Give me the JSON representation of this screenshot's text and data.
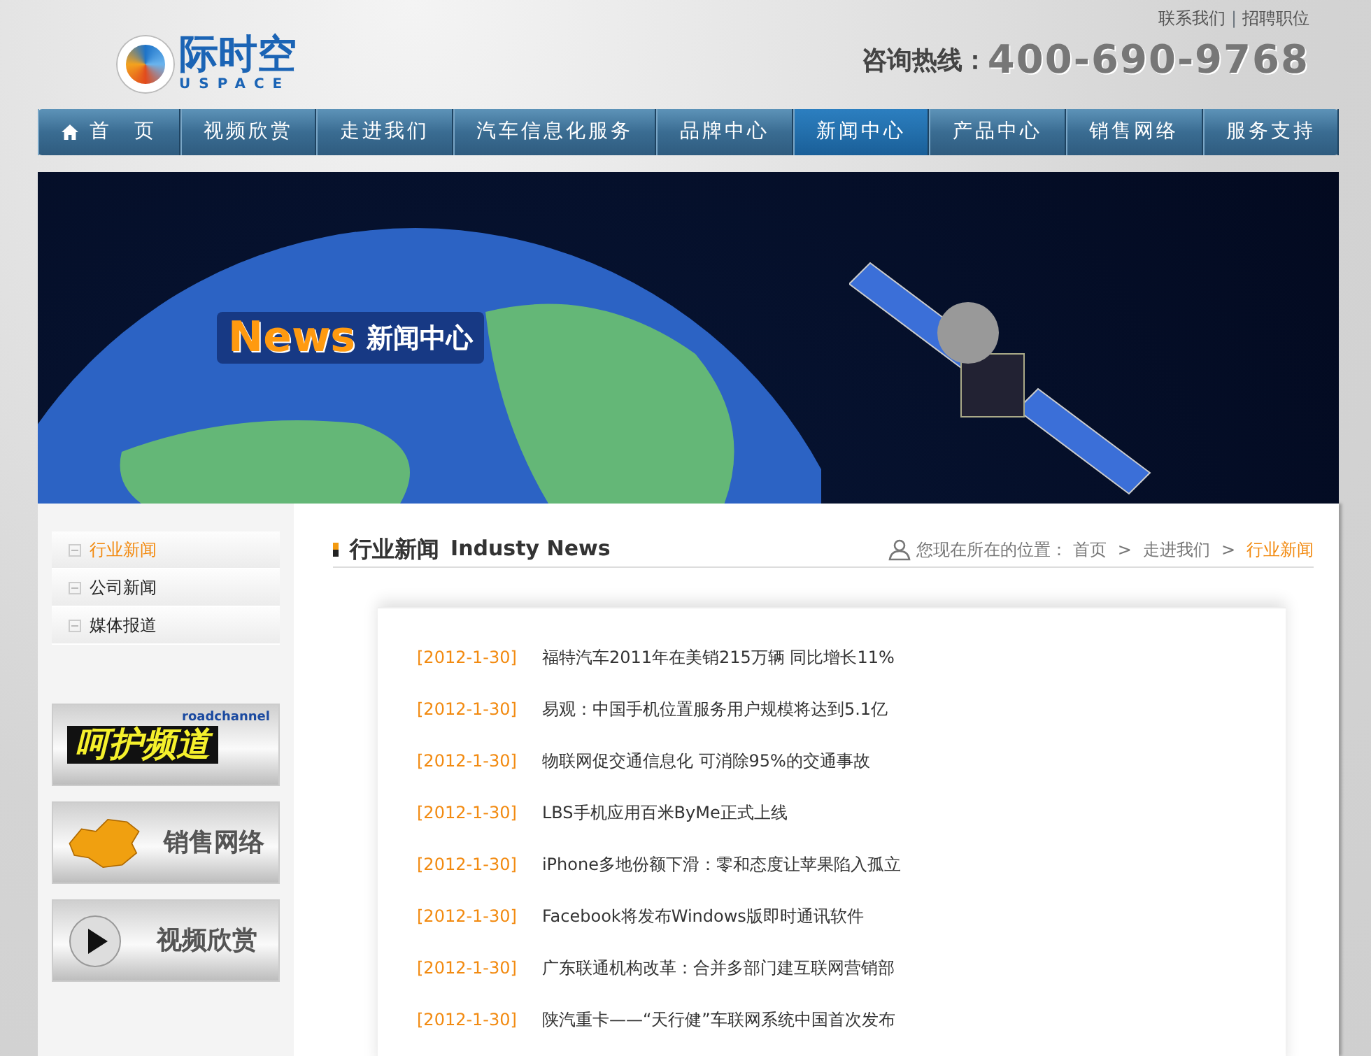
{
  "header": {
    "logo_text": "际时空",
    "logo_subtext": "USPACE",
    "top_links": [
      "联系我们",
      "招聘职位"
    ],
    "top_link_separator": "|",
    "hotline_label": "咨询热线：",
    "hotline_number": "400-690-9768"
  },
  "nav": [
    {
      "label": "首　页",
      "selected": false,
      "kind": "home"
    },
    {
      "label": "视频欣赏",
      "selected": false,
      "kind": "text"
    },
    {
      "label": "走进我们",
      "selected": false,
      "kind": "text"
    },
    {
      "label": "汽车信息化服务",
      "selected": false,
      "kind": "text"
    },
    {
      "label": "品牌中心",
      "selected": false,
      "kind": "text"
    },
    {
      "label": "新闻中心",
      "selected": true,
      "kind": "text"
    },
    {
      "label": "产品中心",
      "selected": false,
      "kind": "text"
    },
    {
      "label": "销售网络",
      "selected": false,
      "kind": "text"
    },
    {
      "label": "服务支持",
      "selected": false,
      "kind": "text"
    }
  ],
  "banner": {
    "title_en": "News",
    "title_cn": "新闻中心"
  },
  "sidebar": {
    "items": [
      {
        "label": "行业新闻",
        "selected": true
      },
      {
        "label": "公司新闻",
        "selected": false
      },
      {
        "label": "媒体报道",
        "selected": false
      }
    ],
    "promos": [
      {
        "kind": "channel",
        "label": "呵护频道",
        "sublabel": "roadchannel"
      },
      {
        "kind": "map",
        "label": "销售网络"
      },
      {
        "kind": "video",
        "label": "视频欣赏"
      }
    ]
  },
  "section": {
    "title_cn": "行业新闻",
    "title_en": "Industy News",
    "breadcrumb_label": "您现在所在的位置：",
    "breadcrumb_separator": ">",
    "breadcrumb": [
      {
        "label": "首页",
        "selected": false
      },
      {
        "label": "走进我们",
        "selected": false
      },
      {
        "label": "行业新闻",
        "selected": true
      }
    ]
  },
  "news": [
    {
      "date": "[2012-1-30]",
      "title": "福特汽车2011年在美销215万辆 同比增长11%"
    },
    {
      "date": "[2012-1-30]",
      "title": "易观：中国手机位置服务用户规模将达到5.1亿"
    },
    {
      "date": "[2012-1-30]",
      "title": "物联网促交通信息化 可消除95%的交通事故"
    },
    {
      "date": "[2012-1-30]",
      "title": "LBS手机应用百米ByMe正式上线"
    },
    {
      "date": "[2012-1-30]",
      "title": "iPhone多地份额下滑：零和态度让苹果陷入孤立"
    },
    {
      "date": "[2012-1-30]",
      "title": "Facebook将发布Windows版即时通讯软件"
    },
    {
      "date": "[2012-1-30]",
      "title": "广东联通机构改革：合并多部门建互联网营销部"
    },
    {
      "date": "[2012-1-30]",
      "title": "陕汽重卡——“天行健”车联网系统中国首次发布"
    }
  ]
}
